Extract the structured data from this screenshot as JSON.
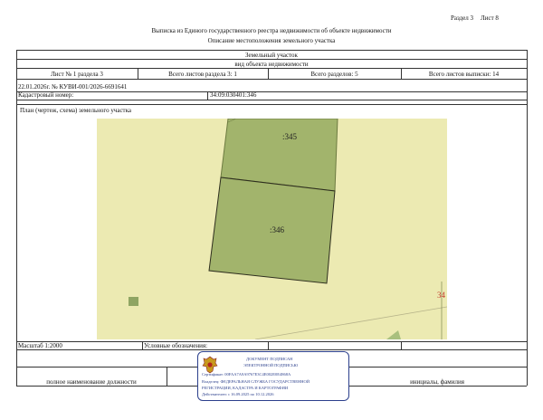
{
  "header": {
    "section_label": "Раздел 3",
    "sheet_label": "Лист 8",
    "title": "Выписка из Единого государственного реестра недвижимости об объекте недвижимости",
    "subtitle": "Описание местоположения земельного участка"
  },
  "object": {
    "type": "Земельный участок",
    "caption": "вид объекта недвижимости"
  },
  "sheet_info": {
    "sheet_of_section": "Лист № 1 раздела 3",
    "total_sheets_section": "Всего листов раздела 3: 1",
    "total_sections": "Всего разделов: 5",
    "total_sheets_extract": "Всего листов выписки: 14"
  },
  "doc_ref": "22.01.2026г. № КУВИ-001/2026-6691641",
  "cadastral": {
    "label": "Кадастровый номер:",
    "value": "34:09:030401:346"
  },
  "plan_caption": "План (чертеж, схема) земельного участка",
  "map": {
    "labels": {
      "upper_parcel": ":345",
      "main_parcel": ":346",
      "edge": "34"
    },
    "colors": {
      "background": "#eceab2",
      "parcel": "#a2b46c",
      "border": "#2e2e1e"
    }
  },
  "footer": {
    "scale": "Масштаб 1:2000",
    "legend_label": "Условные обозначения:",
    "position_label": "полное наименование должности",
    "initials_label": "инициалы, фамилия"
  },
  "stamp": {
    "line1": "ДОКУМЕНТ ПОДПИСАН",
    "line2": "ЭЛЕКТРОННОЙ ПОДПИСЬЮ",
    "cert": "Сертификат: 00FAA7A9A9767E3C4E002E0E4868A",
    "owner": "Владелец: ФЕДЕРАЛЬНАЯ СЛУЖБА ГОСУДАРСТВЕННОЙ",
    "owner2": "РЕГИСТРАЦИИ, КАДАСТРА И КАРТОГРАФИИ",
    "valid": "Действителен: с 16.09.2025 по 10.12.2026",
    "color": "#2b3f8c"
  }
}
